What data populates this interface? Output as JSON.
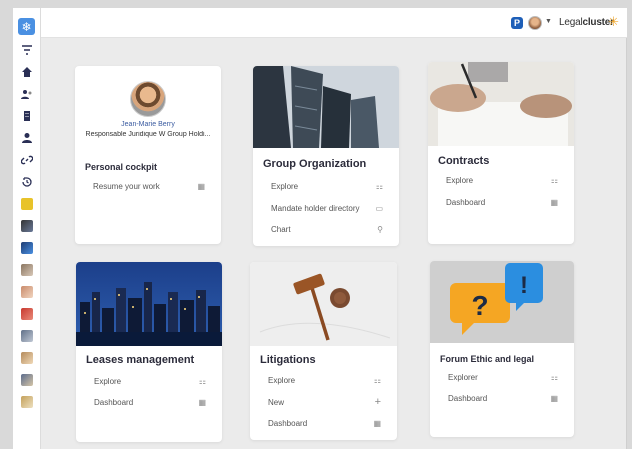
{
  "header": {
    "brand_regular": "Legal",
    "brand_bold": "cluster",
    "p_badge": "P"
  },
  "profile": {
    "name": "Jean-Marie Berry",
    "role": "Responsable Juridique W Group Holdi...",
    "section_title": "Personal cockpit",
    "items": [
      {
        "label": "Resume your work",
        "icon": "grid-icon"
      }
    ]
  },
  "cards": {
    "group": {
      "title": "Group Organization",
      "items": [
        {
          "label": "Explore",
          "icon": "hierarchy-icon"
        },
        {
          "label": "Mandate holder directory",
          "icon": "folder-icon"
        },
        {
          "label": "Chart",
          "icon": "org-chart-icon"
        }
      ]
    },
    "contracts": {
      "title": "Contracts",
      "items": [
        {
          "label": "Explore",
          "icon": "hierarchy-icon"
        },
        {
          "label": "Dashboard",
          "icon": "grid-icon"
        }
      ]
    },
    "leases": {
      "title": "Leases management",
      "items": [
        {
          "label": "Explore",
          "icon": "hierarchy-icon"
        },
        {
          "label": "Dashboard",
          "icon": "grid-icon"
        }
      ]
    },
    "litigations": {
      "title": "Litigations",
      "items": [
        {
          "label": "Explore",
          "icon": "hierarchy-icon"
        },
        {
          "label": "New",
          "icon": "plus-icon"
        },
        {
          "label": "Dashboard",
          "icon": "grid-icon"
        }
      ]
    },
    "forum": {
      "title": "Forum Ethic and legal",
      "items": [
        {
          "label": "Explorer",
          "icon": "hierarchy-icon"
        },
        {
          "label": "Dashboard",
          "icon": "grid-icon"
        }
      ]
    }
  },
  "colors": {
    "accent": "#4a90e2",
    "sidebar_icon": "#2a2f55",
    "card_bg": "#ffffff",
    "page_bg": "#ebebeb"
  }
}
